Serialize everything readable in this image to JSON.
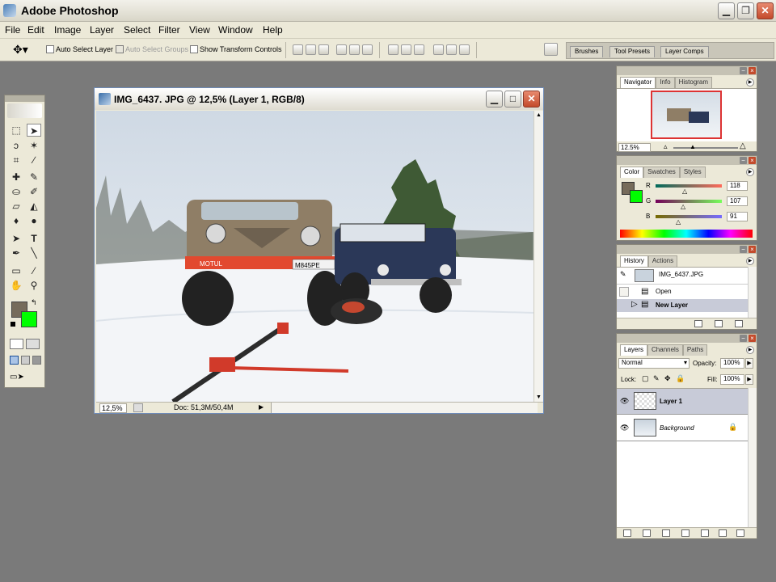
{
  "app": {
    "title": "Adobe Photoshop"
  },
  "menu": [
    "File",
    "Edit",
    "Image",
    "Layer",
    "Select",
    "Filter",
    "View",
    "Window",
    "Help"
  ],
  "options": {
    "auto_select_layer": "Auto Select Layer",
    "auto_select_groups": "Auto Select Groups",
    "show_transform_controls": "Show Transform Controls"
  },
  "palette_well": {
    "tabs": [
      "Brushes",
      "Tool Presets",
      "Layer Comps"
    ]
  },
  "document": {
    "title": "IMG_6437. JPG @ 12,5% (Layer 1, RGB/8)",
    "zoom": "12,5%",
    "doc_info": "Doc: 51,3M/50,4M"
  },
  "photo": {
    "bumper_plate": "MOTUL",
    "license_plate": "М845РЕ"
  },
  "navigator": {
    "tabs": [
      "Navigator",
      "Info",
      "Histogram"
    ],
    "zoom": "12.5%"
  },
  "color": {
    "tabs": [
      "Color",
      "Swatches",
      "Styles"
    ],
    "r_label": "R",
    "g_label": "G",
    "b_label": "B",
    "r": "118",
    "g": "107",
    "b": "91",
    "foreground": "#766b5b",
    "background": "#00ff00"
  },
  "history": {
    "tabs": [
      "History",
      "Actions"
    ],
    "snapshot": "IMG_6437.JPG",
    "items": [
      "Open",
      "New Layer"
    ]
  },
  "layers": {
    "tabs": [
      "Layers",
      "Channels",
      "Paths"
    ],
    "blend_mode": "Normal",
    "opacity_label": "Opacity:",
    "opacity": "100%",
    "lock_label": "Lock:",
    "fill_label": "Fill:",
    "fill": "100%",
    "items": [
      "Layer 1",
      "Background"
    ]
  }
}
